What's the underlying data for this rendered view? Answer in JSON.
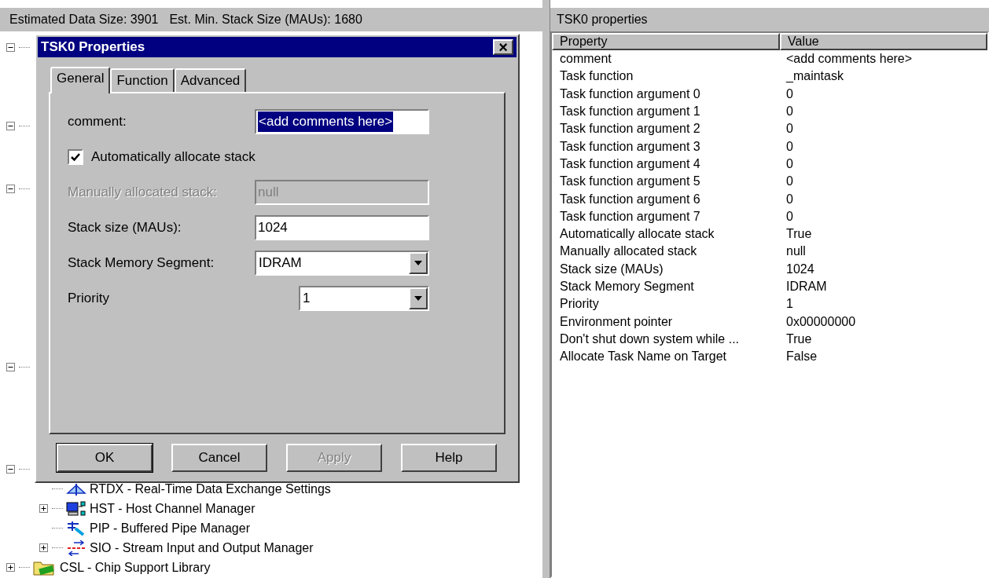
{
  "status_bar": {
    "data_size": "Estimated Data Size: 3901",
    "stack_size": "Est. Min. Stack Size (MAUs): 1680"
  },
  "tree": [
    {
      "expanded": true
    },
    {
      "expanded": true
    },
    {
      "expanded": true
    },
    {
      "expanded": true
    },
    {
      "expanded": true,
      "children": [
        {
          "label": "RTDX - Real-Time Data Exchange Settings",
          "kind": "rtdx"
        },
        {
          "label": "HST - Host Channel Manager",
          "kind": "hst",
          "expanded": false
        },
        {
          "label": "PIP - Buffered Pipe Manager",
          "kind": "pip"
        },
        {
          "label": "SIO - Stream Input and Output Manager",
          "kind": "sio",
          "expanded": false
        }
      ]
    },
    {
      "label": "CSL - Chip Support Library",
      "kind": "csl",
      "expanded": false
    }
  ],
  "dialog": {
    "title": "TSK0 Properties",
    "close": "×",
    "tabs": [
      {
        "label": "General",
        "selected": true
      },
      {
        "label": "Function",
        "selected": false
      },
      {
        "label": "Advanced",
        "selected": false
      }
    ],
    "fields": [
      {
        "kind": "text",
        "label": "comment:",
        "value": "<add comments here>",
        "highlighted": true,
        "disabled": false
      },
      {
        "kind": "checkbox",
        "label": "Automatically allocate stack",
        "checked": true
      },
      {
        "kind": "text",
        "label": "Manually allocated stack:",
        "value": "null",
        "highlighted": false,
        "disabled": true
      },
      {
        "kind": "text",
        "label": "Stack size (MAUs):",
        "value": "1024",
        "highlighted": false,
        "disabled": false
      },
      {
        "kind": "select",
        "label": "Stack Memory Segment:",
        "value": "IDRAM",
        "wide": true
      },
      {
        "kind": "select",
        "label": "Priority",
        "value": "1",
        "wide": false
      }
    ],
    "buttons": [
      {
        "label": "OK",
        "default": true,
        "disabled": false
      },
      {
        "label": "Cancel",
        "default": false,
        "disabled": false
      },
      {
        "label": "Apply",
        "default": false,
        "disabled": true
      },
      {
        "label": "Help",
        "default": false,
        "disabled": false
      }
    ]
  },
  "properties": {
    "title": "TSK0 properties",
    "columns": [
      "Property",
      "Value"
    ],
    "rows": [
      [
        "comment",
        "<add comments here>"
      ],
      [
        "Task function",
        "_maintask"
      ],
      [
        "Task function argument 0",
        "0"
      ],
      [
        "Task function argument 1",
        "0"
      ],
      [
        "Task function argument 2",
        "0"
      ],
      [
        "Task function argument 3",
        "0"
      ],
      [
        "Task function argument 4",
        "0"
      ],
      [
        "Task function argument 5",
        "0"
      ],
      [
        "Task function argument 6",
        "0"
      ],
      [
        "Task function argument 7",
        "0"
      ],
      [
        "Automatically allocate stack",
        "True"
      ],
      [
        "Manually allocated stack",
        "null"
      ],
      [
        "Stack size (MAUs)",
        "1024"
      ],
      [
        "Stack Memory Segment",
        "IDRAM"
      ],
      [
        "Priority",
        "1"
      ],
      [
        "Environment pointer",
        "0x00000000"
      ],
      [
        "Don't shut down system while ...",
        "True"
      ],
      [
        "Allocate Task Name on Target",
        "False"
      ]
    ]
  }
}
